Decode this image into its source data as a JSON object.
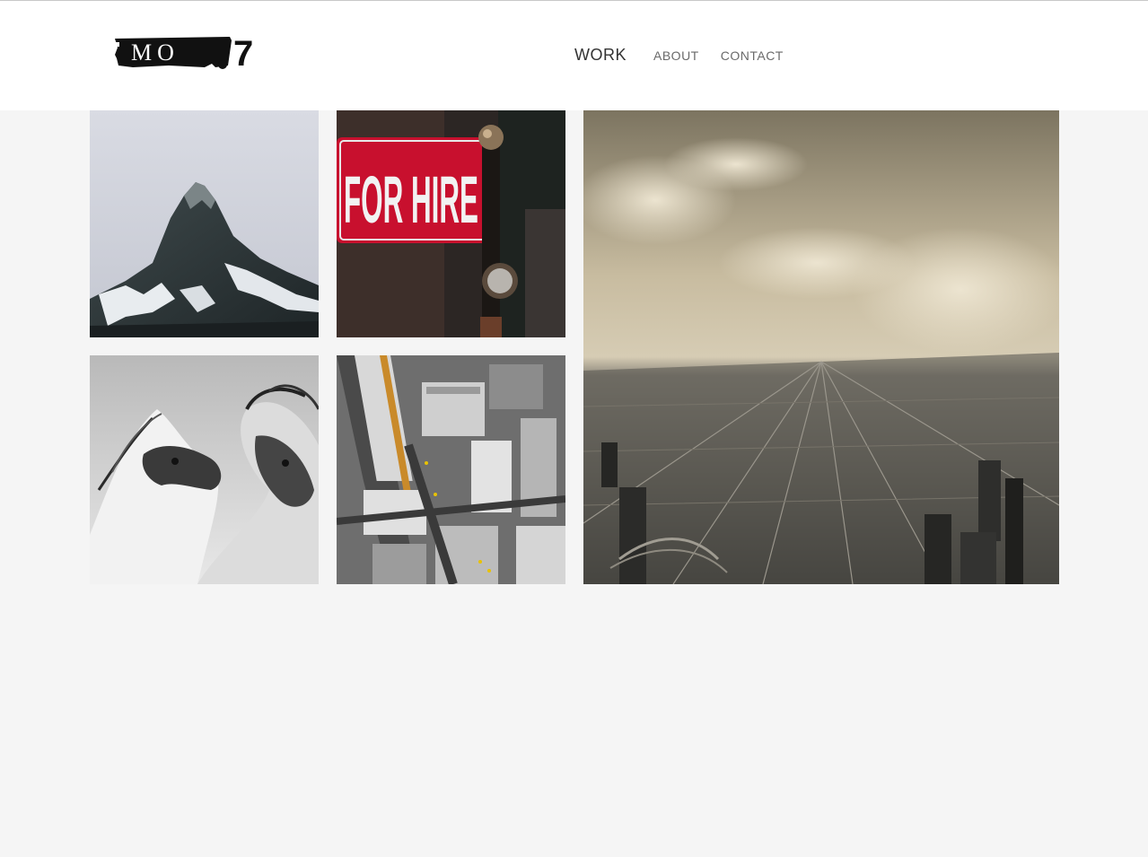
{
  "logo": {
    "text": "MO",
    "digit": "7"
  },
  "nav": {
    "items": [
      {
        "label": "WORK",
        "active": true
      },
      {
        "label": "ABOUT",
        "active": false
      },
      {
        "label": "CONTACT",
        "active": false
      }
    ]
  },
  "gallery": {
    "tiles": [
      {
        "subject": "mountain-peak"
      },
      {
        "subject": "for-hire-sign",
        "sign_text": "FOR HIRE"
      },
      {
        "subject": "horses"
      },
      {
        "subject": "city-aerial-view"
      },
      {
        "subject": "city-skyline-clouds"
      }
    ]
  },
  "colors": {
    "background": "#f5f5f5",
    "header": "#ffffff",
    "nav_active": "#333333",
    "nav_inactive": "#6a6a6a",
    "sign_red": "#c8102e"
  }
}
